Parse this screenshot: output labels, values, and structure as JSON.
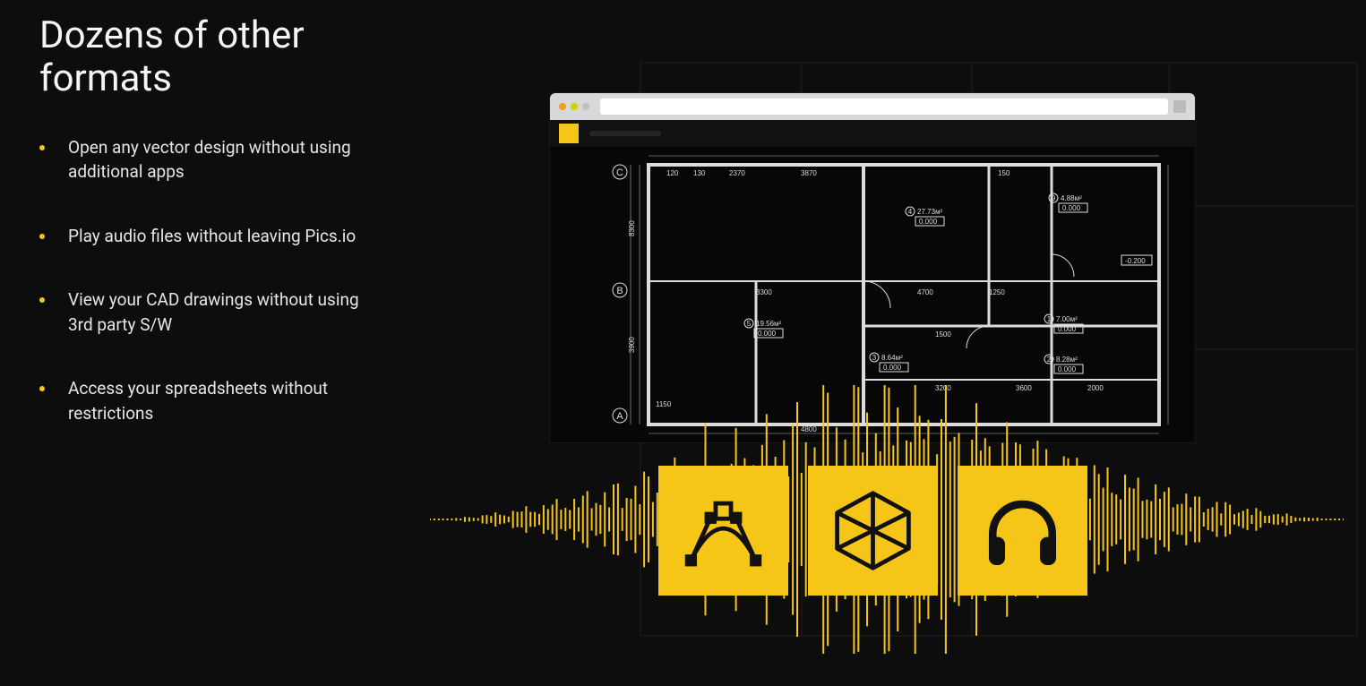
{
  "heading": "Dozens of other formats",
  "bullets": [
    "Open any vector design without using additional apps",
    "Play audio files without leaving Pics.io",
    "View your CAD drawings without using 3rd party S/W",
    "Access your spreadsheets without restrictions"
  ],
  "accent_color": "#f5c518",
  "tiles": [
    {
      "name": "vector-icon"
    },
    {
      "name": "3d-cube-icon"
    },
    {
      "name": "headphones-icon"
    }
  ],
  "blueprint_labels": {
    "rows": [
      "C",
      "B",
      "A"
    ],
    "rooms": [
      {
        "num": "4",
        "area": "27.73м²",
        "sub": "0.000"
      },
      {
        "num": "9",
        "area": "4.88м²",
        "sub": "0.000"
      },
      {
        "num": "1",
        "area": "7.00м²",
        "sub": "0.000"
      },
      {
        "num": "2",
        "area": "8.28м²",
        "sub": "0.000"
      },
      {
        "num": "3",
        "area": "8.64м²",
        "sub": "0.000"
      },
      {
        "num": "5",
        "area": "19.56м²",
        "sub": "0.000"
      }
    ],
    "dims": [
      "120",
      "130",
      "2370",
      "3870",
      "150",
      "8300",
      "3900",
      "3300",
      "4700",
      "1250",
      "1500",
      "3200",
      "3600",
      "2000",
      "1150",
      "4800",
      "-0.200"
    ]
  }
}
